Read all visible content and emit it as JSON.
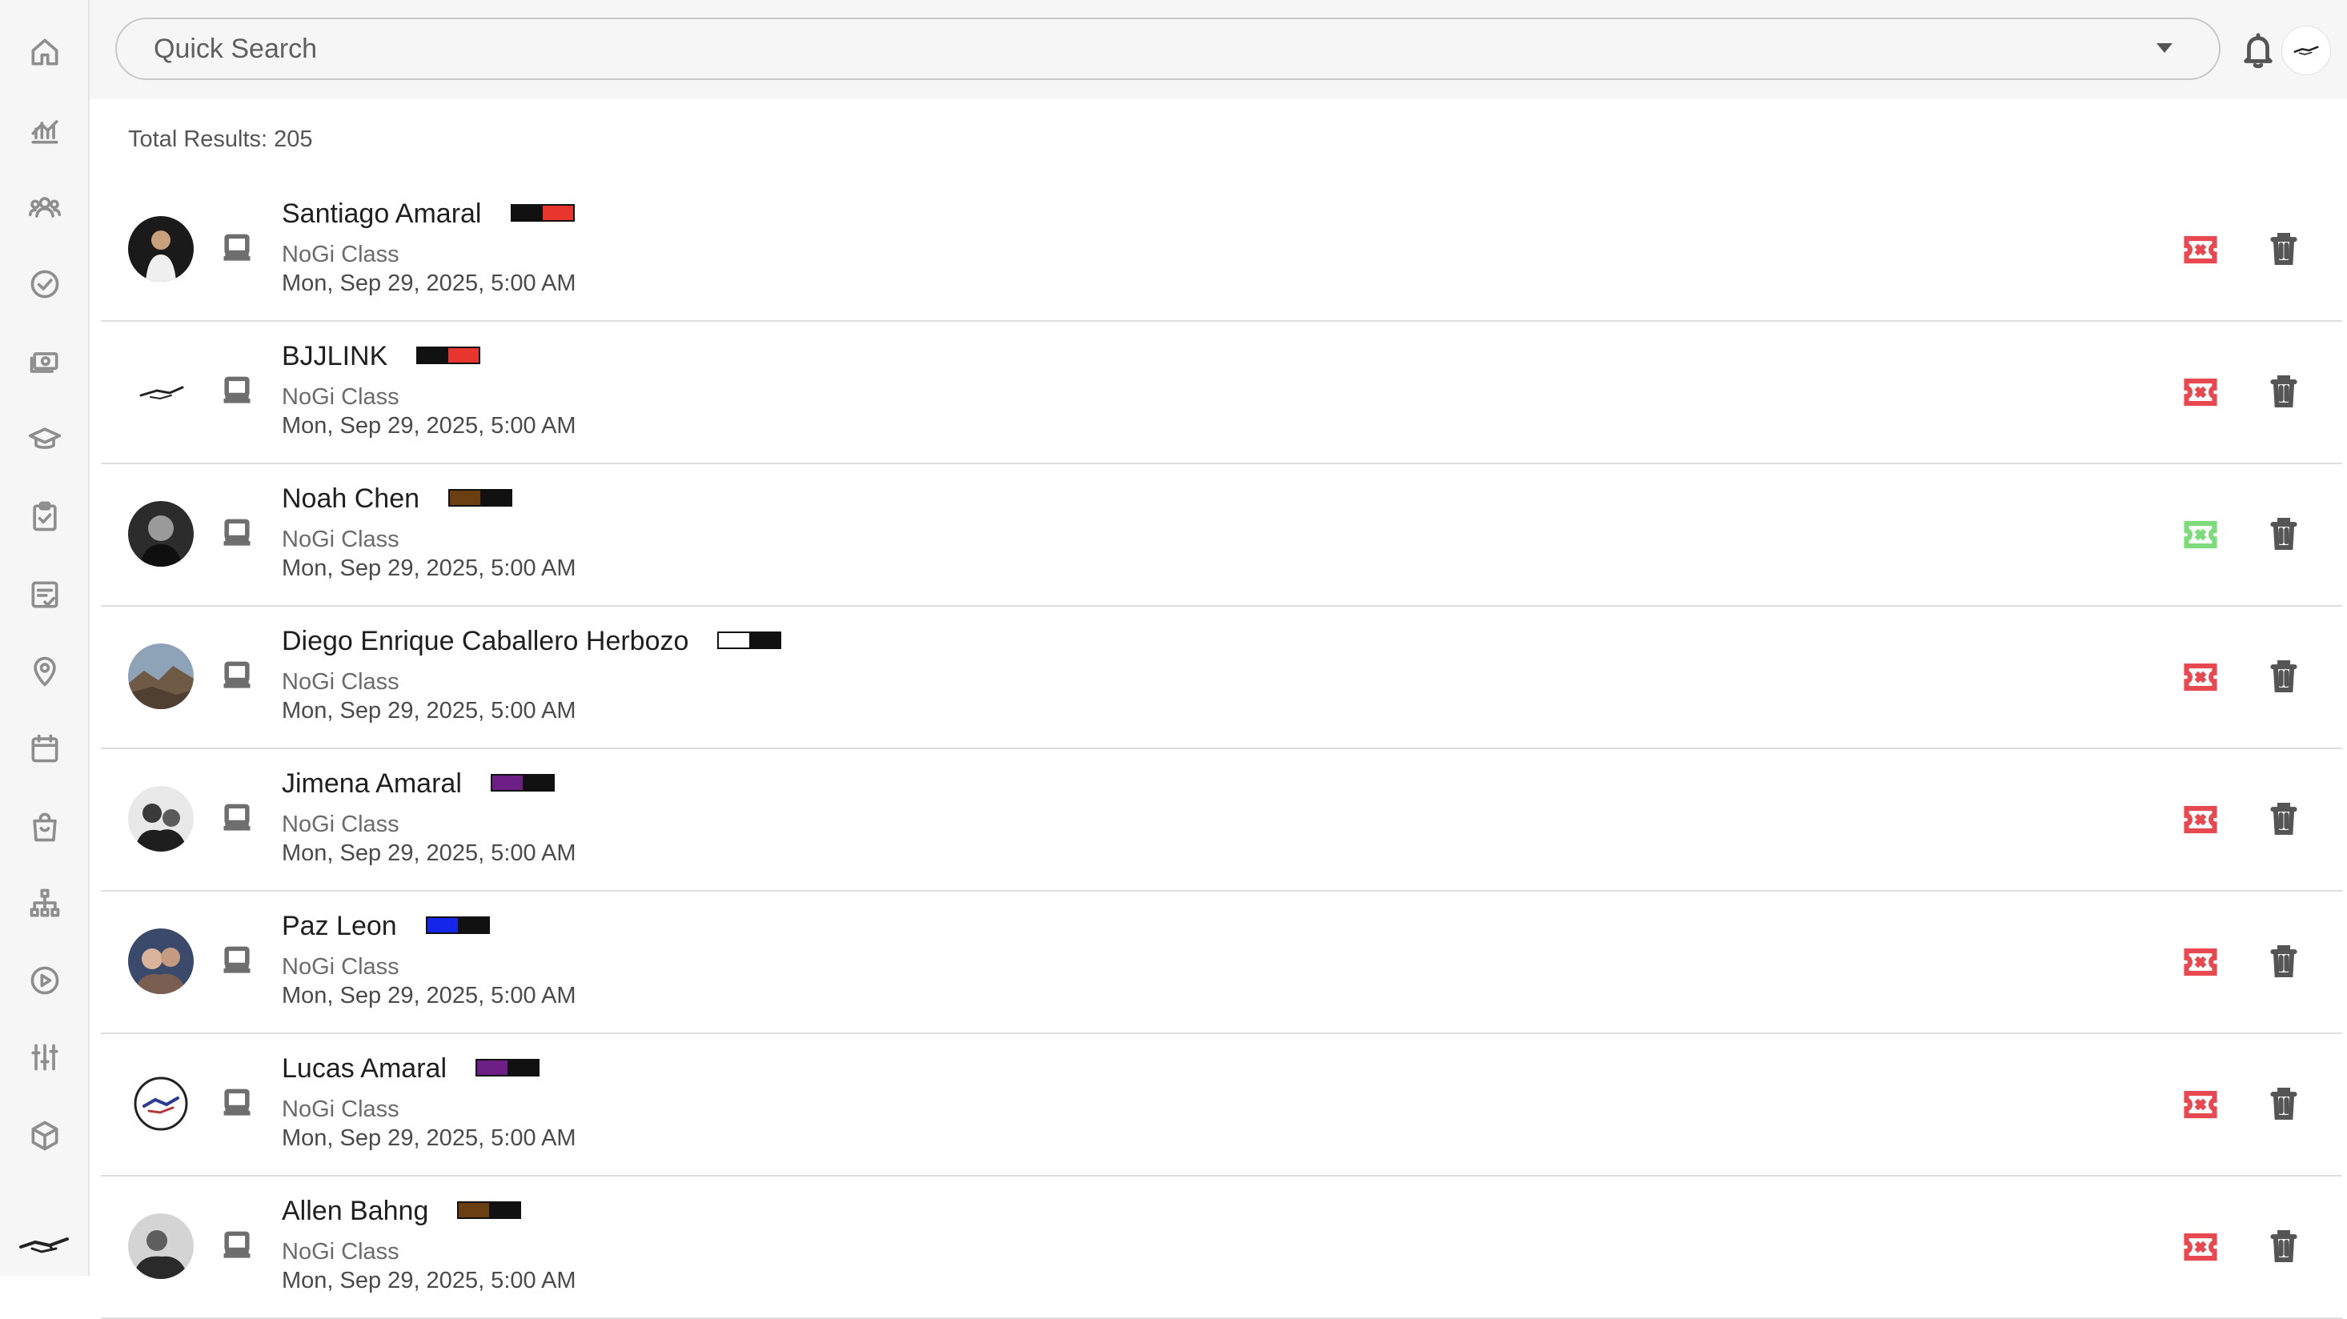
{
  "search": {
    "placeholder": "Quick Search"
  },
  "results": {
    "total_label": "Total Results: 205"
  },
  "colors": {
    "ticket_red": "#e8484f",
    "ticket_green": "#7ddc7a"
  },
  "sidebar": {
    "items": [
      {
        "icon": "home-icon"
      },
      {
        "icon": "analytics-icon"
      },
      {
        "icon": "members-icon"
      },
      {
        "icon": "check-circle-icon"
      },
      {
        "icon": "payments-icon"
      },
      {
        "icon": "graduation-cap-icon"
      },
      {
        "icon": "clipboard-check-icon"
      },
      {
        "icon": "checklist-icon"
      },
      {
        "icon": "location-pin-icon"
      },
      {
        "icon": "calendar-icon"
      },
      {
        "icon": "shopping-bag-icon"
      },
      {
        "icon": "hierarchy-icon"
      },
      {
        "icon": "play-circle-icon"
      },
      {
        "icon": "sliders-icon"
      },
      {
        "icon": "cube-icon"
      }
    ]
  },
  "rows": [
    {
      "name": "Santiago Amaral",
      "class": "NoGi Class",
      "date": "Mon, Sep 29, 2025, 5:00 AM",
      "belt": [
        "#111111",
        "#e8352e"
      ],
      "ticket": "red"
    },
    {
      "name": "BJJLINK",
      "class": "NoGi Class",
      "date": "Mon, Sep 29, 2025, 5:00 AM",
      "belt": [
        "#111111",
        "#e8352e"
      ],
      "ticket": "red"
    },
    {
      "name": "Noah Chen",
      "class": "NoGi Class",
      "date": "Mon, Sep 29, 2025, 5:00 AM",
      "belt": [
        "#6b3f12",
        "#111111"
      ],
      "ticket": "green"
    },
    {
      "name": "Diego Enrique Caballero Herbozo",
      "class": "NoGi Class",
      "date": "Mon, Sep 29, 2025, 5:00 AM",
      "belt": [
        "#ffffff",
        "#111111"
      ],
      "ticket": "red"
    },
    {
      "name": "Jimena Amaral",
      "class": "NoGi Class",
      "date": "Mon, Sep 29, 2025, 5:00 AM",
      "belt": [
        "#6e1f86",
        "#111111"
      ],
      "ticket": "red"
    },
    {
      "name": "Paz Leon",
      "class": "NoGi Class",
      "date": "Mon, Sep 29, 2025, 5:00 AM",
      "belt": [
        "#1426e8",
        "#111111"
      ],
      "ticket": "red"
    },
    {
      "name": "Lucas Amaral",
      "class": "NoGi Class",
      "date": "Mon, Sep 29, 2025, 5:00 AM",
      "belt": [
        "#6e1f86",
        "#111111"
      ],
      "ticket": "red"
    },
    {
      "name": "Allen Bahng",
      "class": "NoGi Class",
      "date": "Mon, Sep 29, 2025, 5:00 AM",
      "belt": [
        "#6b3f12",
        "#111111"
      ],
      "ticket": "red"
    }
  ]
}
